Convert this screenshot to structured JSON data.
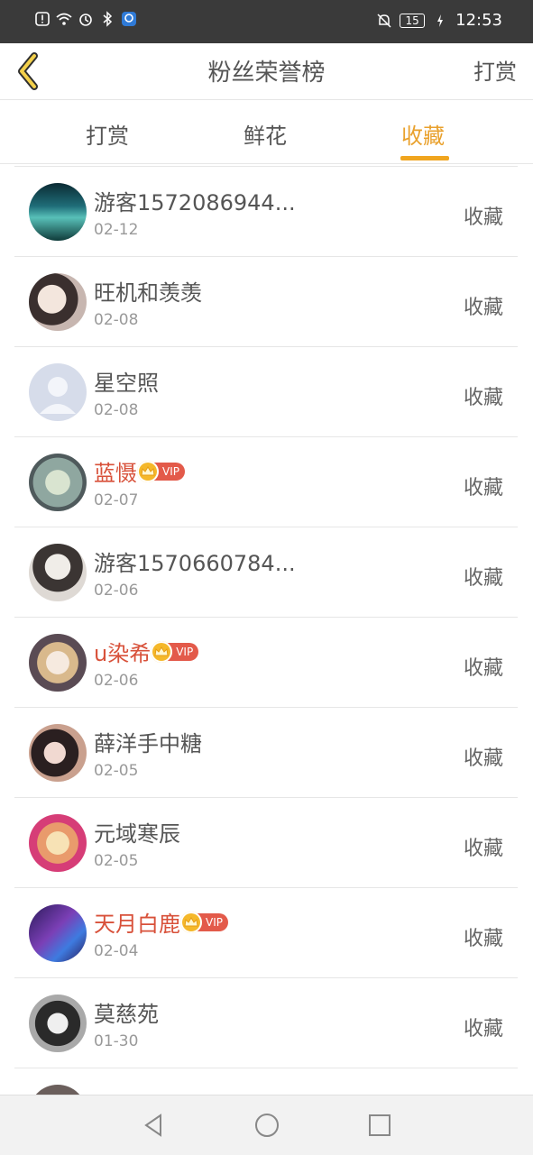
{
  "status_bar": {
    "time": "12:53",
    "battery": "15",
    "icons_left": [
      "alert-icon",
      "wifi-icon",
      "alarm-icon",
      "bluetooth-icon",
      "app-icon"
    ],
    "icons_right": [
      "mute-bell-icon",
      "battery-icon",
      "charging-icon"
    ]
  },
  "header": {
    "title": "粉丝荣誉榜",
    "action": "打赏"
  },
  "tabs": [
    {
      "label": "打赏",
      "active": false
    },
    {
      "label": "鲜花",
      "active": false
    },
    {
      "label": "收藏",
      "active": true
    }
  ],
  "colors": {
    "accent": "#f0a51f",
    "vip_name": "#d8513a",
    "vip_badge": "#e35a4a"
  },
  "vip_label": "VIP",
  "list": [
    {
      "name": "游客1572086944...",
      "date": "02-12",
      "action": "收藏",
      "vip": false
    },
    {
      "name": "旺机和羡羡",
      "date": "02-08",
      "action": "收藏",
      "vip": false
    },
    {
      "name": "星空照",
      "date": "02-08",
      "action": "收藏",
      "vip": false
    },
    {
      "name": "蓝慑",
      "date": "02-07",
      "action": "收藏",
      "vip": true
    },
    {
      "name": "游客1570660784...",
      "date": "02-06",
      "action": "收藏",
      "vip": false
    },
    {
      "name": "u染希",
      "date": "02-06",
      "action": "收藏",
      "vip": true
    },
    {
      "name": "薛洋手中糖",
      "date": "02-05",
      "action": "收藏",
      "vip": false
    },
    {
      "name": "元域寒辰",
      "date": "02-05",
      "action": "收藏",
      "vip": false
    },
    {
      "name": "天月白鹿",
      "date": "02-04",
      "action": "收藏",
      "vip": true
    },
    {
      "name": "莫慈苑",
      "date": "01-30",
      "action": "收藏",
      "vip": false
    }
  ],
  "navbar": [
    "back-triangle-icon",
    "home-circle-icon",
    "recent-square-icon"
  ]
}
